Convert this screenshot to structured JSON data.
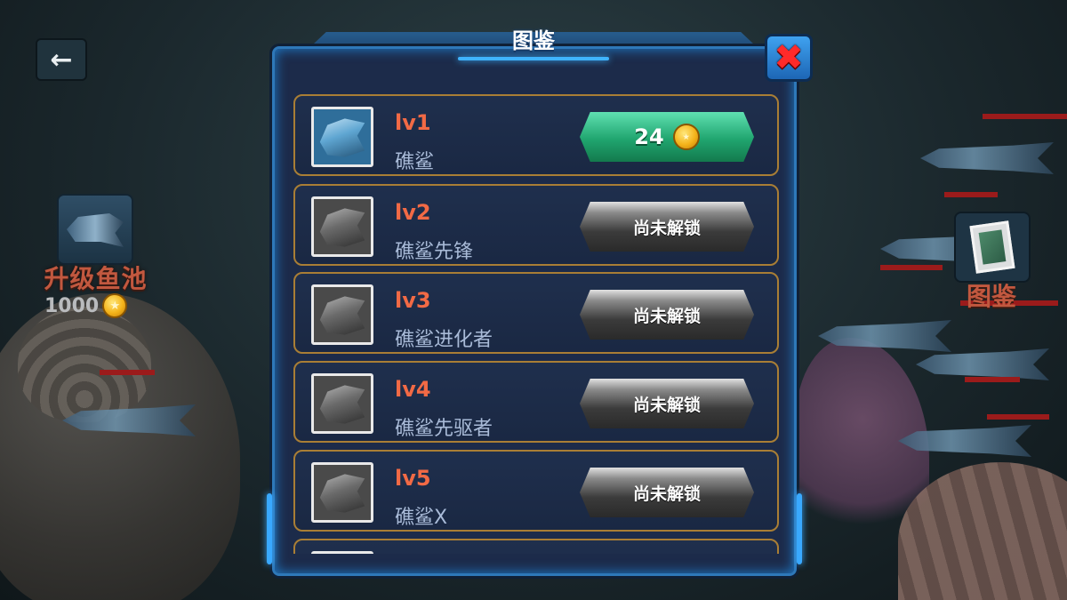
{
  "hud": {
    "back_icon": "arrow-left-icon",
    "upgrade_pool": {
      "label": "升级鱼池",
      "cost": "1000",
      "icon": "shark-icon"
    },
    "atlas": {
      "label": "图鉴",
      "icon": "card-album-icon"
    }
  },
  "panel": {
    "title": "图鉴",
    "close_icon": "close-x-icon",
    "items": [
      {
        "level": "lv1",
        "name": "礁鲨",
        "status": "unlocked",
        "price": "24"
      },
      {
        "level": "lv2",
        "name": "礁鲨先锋",
        "status": "locked",
        "button": "尚未解锁"
      },
      {
        "level": "lv3",
        "name": "礁鲨进化者",
        "status": "locked",
        "button": "尚未解锁"
      },
      {
        "level": "lv4",
        "name": "礁鲨先驱者",
        "status": "locked",
        "button": "尚未解锁"
      },
      {
        "level": "lv5",
        "name": "礁鲨X",
        "status": "locked",
        "button": "尚未解锁"
      }
    ]
  },
  "colors": {
    "level_text": "#f26a45",
    "name_text": "#a9bbd8",
    "panel_border": "#2e78b9",
    "row_border": "#a97e35",
    "buy_button": "#20a56f",
    "close_x": "#ff2a2a"
  }
}
